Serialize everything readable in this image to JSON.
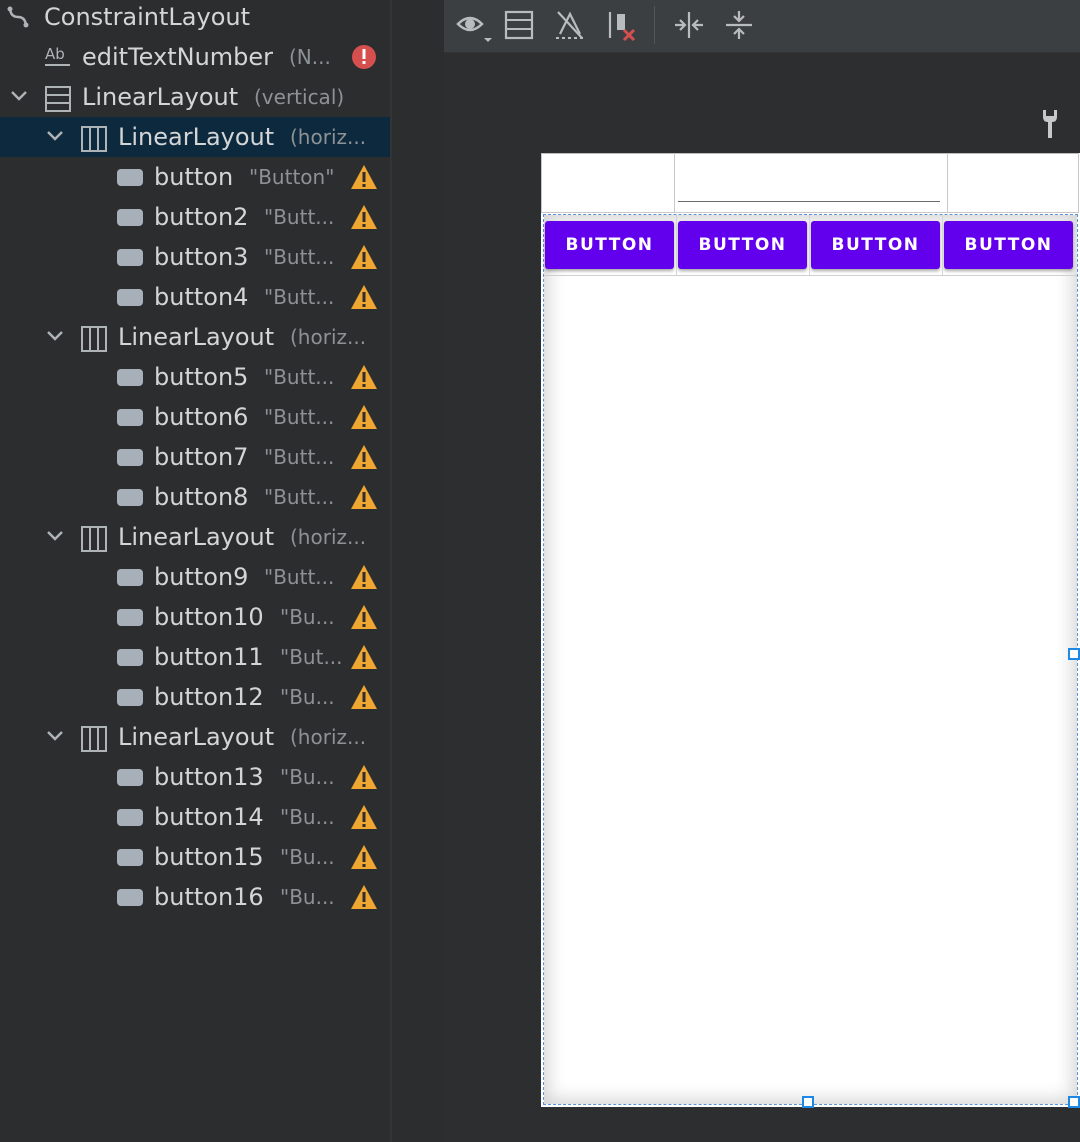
{
  "tree": {
    "items": [
      {
        "name": "ConstraintLayout",
        "attr": "",
        "icon": "constraint-layout-icon",
        "status": ""
      },
      {
        "name": "editTextNumber",
        "attr": "(N...",
        "icon": "edit-text-icon",
        "status": "error"
      },
      {
        "name": "LinearLayout",
        "attr": "(vertical)",
        "icon": "vertical-linear-layout-icon",
        "status": ""
      },
      {
        "name": "LinearLayout",
        "attr": "(horiz...",
        "icon": "horizontal-linear-layout-icon",
        "status": "",
        "selected": true
      },
      {
        "name": "button",
        "attr": "\"Button\"",
        "icon": "button-icon",
        "status": "warning"
      },
      {
        "name": "button2",
        "attr": "\"Butt...",
        "icon": "button-icon",
        "status": "warning"
      },
      {
        "name": "button3",
        "attr": "\"Butt...",
        "icon": "button-icon",
        "status": "warning"
      },
      {
        "name": "button4",
        "attr": "\"Butt...",
        "icon": "button-icon",
        "status": "warning"
      },
      {
        "name": "LinearLayout",
        "attr": "(horiz...",
        "icon": "horizontal-linear-layout-icon",
        "status": ""
      },
      {
        "name": "button5",
        "attr": "\"Butt...",
        "icon": "button-icon",
        "status": "warning"
      },
      {
        "name": "button6",
        "attr": "\"Butt...",
        "icon": "button-icon",
        "status": "warning"
      },
      {
        "name": "button7",
        "attr": "\"Butt...",
        "icon": "button-icon",
        "status": "warning"
      },
      {
        "name": "button8",
        "attr": "\"Butt...",
        "icon": "button-icon",
        "status": "warning"
      },
      {
        "name": "LinearLayout",
        "attr": "(horiz...",
        "icon": "horizontal-linear-layout-icon",
        "status": ""
      },
      {
        "name": "button9",
        "attr": "\"Butt...",
        "icon": "button-icon",
        "status": "warning"
      },
      {
        "name": "button10",
        "attr": "\"Bu...",
        "icon": "button-icon",
        "status": "warning"
      },
      {
        "name": "button11",
        "attr": "\"But...",
        "icon": "button-icon",
        "status": "warning"
      },
      {
        "name": "button12",
        "attr": "\"Bu...",
        "icon": "button-icon",
        "status": "warning"
      },
      {
        "name": "LinearLayout",
        "attr": "(horiz...",
        "icon": "horizontal-linear-layout-icon",
        "status": ""
      },
      {
        "name": "button13",
        "attr": "\"Bu...",
        "icon": "button-icon",
        "status": "warning"
      },
      {
        "name": "button14",
        "attr": "\"Bu...",
        "icon": "button-icon",
        "status": "warning"
      },
      {
        "name": "button15",
        "attr": "\"Bu...",
        "icon": "button-icon",
        "status": "warning"
      },
      {
        "name": "button16",
        "attr": "\"Bu...",
        "icon": "button-icon",
        "status": "warning"
      }
    ]
  },
  "toolbar": {
    "buttons": [
      "eye-icon",
      "layout-bounds-icon",
      "disable-autoconnect-icon",
      "clear-constraints-icon",
      "pack-horizontal-icon",
      "pack-vertical-icon"
    ]
  },
  "design": {
    "buttons": [
      {
        "label": "BUTTON"
      },
      {
        "label": "BUTTON"
      },
      {
        "label": "BUTTON"
      },
      {
        "label": "BUTTON"
      }
    ]
  },
  "colors": {
    "button_purple": "#6200ee",
    "selection_blue": "#1e88e5",
    "warning": "#f0a732",
    "error": "#d64f4f"
  }
}
